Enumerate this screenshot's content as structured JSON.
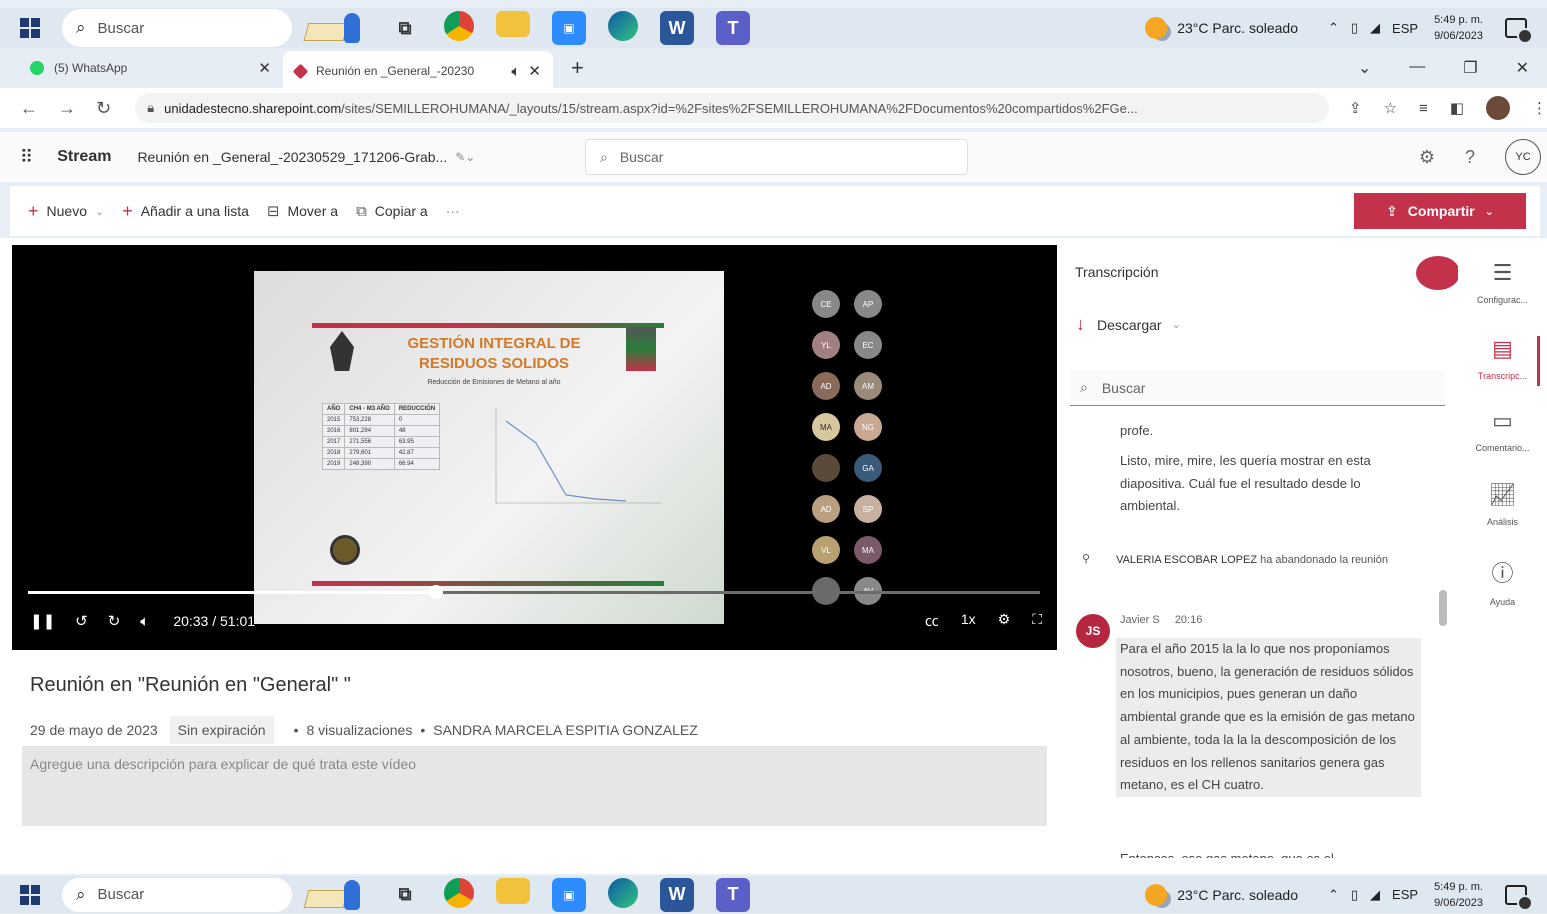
{
  "taskbar": {
    "search_placeholder": "Buscar",
    "weather": "23°C  Parc. soleado",
    "lang": "ESP",
    "time": "5:49 p. m.",
    "date": "9/06/2023"
  },
  "browser": {
    "tabs": [
      {
        "title": "(5) WhatsApp",
        "color": "#25d366"
      },
      {
        "title": "Reunión en _General_-20230",
        "color": "#c4314b"
      }
    ],
    "url_host": "unidadestecno.sharepoint.com",
    "url_path": "/sites/SEMILLEROHUMANA/_layouts/15/stream.aspx?id=%2Fsites%2FSEMILLEROHUMANA%2FDocumentos%20compartidos%2FGe..."
  },
  "stream": {
    "app_name": "Stream",
    "file_name": "Reunión en _General_-20230529_171206-Grab...",
    "search_placeholder": "Buscar",
    "user_initials": "YC"
  },
  "commands": {
    "new": "Nuevo",
    "add_list": "Añadir a una lista",
    "move": "Mover a",
    "copy": "Copiar a",
    "more": "···",
    "share": "Compartir"
  },
  "player": {
    "time": "20:33 / 51:01",
    "speed": "1x",
    "progress": 0.403,
    "slide": {
      "title": "GESTIÓN INTEGRAL DE RESIDUOS SOLIDOS",
      "subtitle": "Reducción de Emisiones de Metano al año",
      "table_headers": [
        "AÑO",
        "CH4 - M3 AÑO",
        "REDUCCIÓN"
      ],
      "table_rows": [
        [
          "2015",
          "753,228",
          "0"
        ],
        [
          "2016",
          "801,294",
          "48"
        ],
        [
          "2017",
          "271,556",
          "63.95"
        ],
        [
          "2018",
          "279,601",
          "42.87"
        ],
        [
          "2019",
          "248,390",
          "66.94"
        ]
      ]
    },
    "participants": [
      "CE",
      "AP",
      "YL",
      "EC",
      "AD",
      "AM",
      "MA",
      "NG",
      "",
      "GA",
      "AD",
      "SP",
      "VL",
      "MA",
      "",
      "AV"
    ]
  },
  "video": {
    "title": "Reunión en \"Reunión en \"General\" \"",
    "date": "29 de mayo de 2023",
    "expiration": "Sin expiración",
    "views": "8 visualizaciones",
    "owner": "SANDRA MARCELA ESPITIA GONZALEZ",
    "description_placeholder": "Agregue una descripción para explicar de qué trata este vídeo"
  },
  "transcript": {
    "heading": "Transcripción",
    "download": "Descargar",
    "search_placeholder": "Buscar",
    "entry1_line": "profe.",
    "entry1_text": "Listo, mire, mire, les quería mostrar en esta diapositiva. Cuál fue el resultado desde lo ambiental.",
    "system_name": "VALERIA ESCOBAR LOPEZ",
    "system_text": " ha abandonado la reunión",
    "speaker_initials": "JS",
    "speaker": "Javier S",
    "speaker_time": "20:16",
    "entry2_text": "Para el año 2015 la la lo que nos proponíamos nosotros, bueno, la generación de residuos sólidos en los municipios, pues generan un daño ambiental grande que es la emisión de gas metano al ambiente, toda la la la descomposición de los residuos en los rellenos sanitarios genera gas metano, es el CH cuatro.",
    "entry3_text": "Entonces, ese gas metano, que es el"
  },
  "rail": [
    {
      "label": "Configurac...",
      "icon": "settings-icon"
    },
    {
      "label": "Transcripc...",
      "icon": "transcript-icon"
    },
    {
      "label": "Comentario...",
      "icon": "comment-icon"
    },
    {
      "label": "Análisis",
      "icon": "analytics-icon"
    },
    {
      "label": "Ayuda",
      "icon": "help-icon"
    }
  ]
}
